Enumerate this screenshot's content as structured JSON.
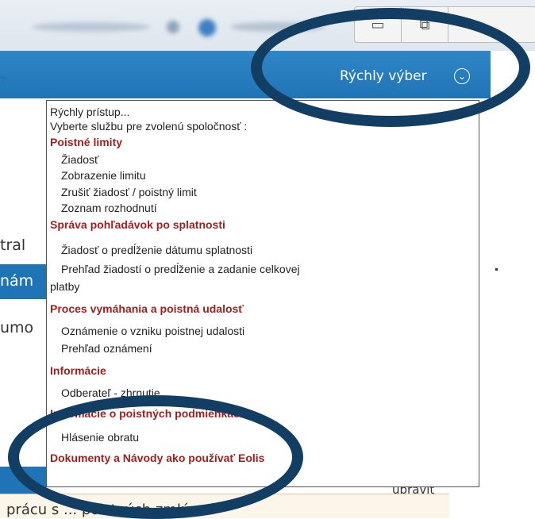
{
  "window": {
    "help_mark": "?",
    "buttons": [
      {
        "name": "minimize",
        "glyph": "▭"
      },
      {
        "name": "restore",
        "glyph": "⧉"
      },
      {
        "name": "close",
        "glyph": "✕"
      }
    ]
  },
  "header": {
    "quick_select_label": "Rýchly výber",
    "quick_select_icon": "chevron-down-circle-icon",
    "accent_color": "#1f74b6"
  },
  "left_fragments": {
    "central": "tral",
    "blue": "nám",
    "doc": "umo"
  },
  "bottom": {
    "text": "prácu s ... poistných zmlúv",
    "edit": "upraviť"
  },
  "menu": {
    "quick_access": "Rýchly prístup...",
    "choose_service": "Vyberte službu pre zvolenú spoločnosť :",
    "sections": [
      {
        "title": "Poistné limity",
        "items": [
          "Žiadosť",
          "Zobrazenie limitu",
          "Zrušiť žiadosť / poistný limit",
          "Zoznam rozhodnutí"
        ]
      },
      {
        "title": "Správa pohľadávok po splatnosti",
        "items": [
          "Žiadosť o predĺženie dátumu splatnosti",
          "Prehľad žiadostí o predĺženie a zadanie celkovej",
          "platby"
        ]
      },
      {
        "title": "Proces vymáhania a poistná udalosť",
        "items": [
          "Oznámenie o vzniku poistnej udalosti",
          "Prehľad oznámení"
        ]
      },
      {
        "title": "Informácie",
        "items": [
          "Odberateľ - zhrnutie"
        ]
      },
      {
        "title": "Informácie o poistných podmienkach",
        "items": [
          "Hlásenie obratu"
        ]
      },
      {
        "title": "Dokumenty a Návody ako používať Eolis",
        "items": []
      }
    ]
  },
  "annotations": {
    "ring_color": "#123e63"
  }
}
